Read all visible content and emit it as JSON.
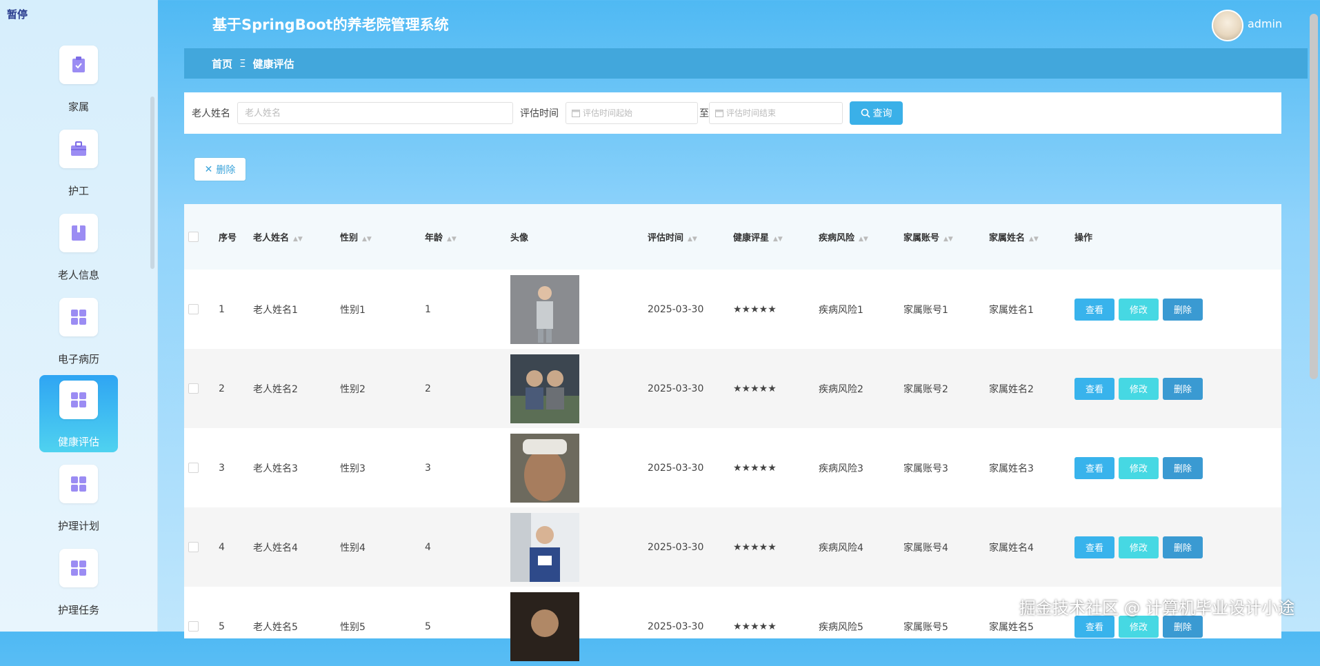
{
  "sidebar": {
    "pause_label": "暂停",
    "items": [
      {
        "label": "家属",
        "icon": "clipboard-check-icon"
      },
      {
        "label": "护工",
        "icon": "briefcase-icon"
      },
      {
        "label": "老人信息",
        "icon": "book-icon"
      },
      {
        "label": "电子病历",
        "icon": "grid-icon"
      },
      {
        "label": "健康评估",
        "icon": "grid-icon",
        "active": true
      },
      {
        "label": "护理计划",
        "icon": "grid-icon"
      },
      {
        "label": "护理任务",
        "icon": "grid-icon"
      }
    ]
  },
  "header": {
    "title": "基于SpringBoot的养老院管理系统",
    "username": "admin"
  },
  "breadcrumb": {
    "home": "首页",
    "separator": "Ξ",
    "current": "健康评估"
  },
  "search": {
    "name_label": "老人姓名",
    "name_placeholder": "老人姓名",
    "time_label": "评估时间",
    "start_placeholder": "评估时间起始",
    "to_label": "至",
    "end_placeholder": "评估时间结束",
    "query_label": "查询"
  },
  "toolbar": {
    "delete_label": "删除"
  },
  "table": {
    "headers": {
      "no": "序号",
      "name": "老人姓名",
      "sex": "性别",
      "age": "年龄",
      "photo": "头像",
      "time": "评估时间",
      "rating": "健康评星",
      "risk": "疾病风险",
      "account": "家属账号",
      "fname": "家属姓名",
      "ops": "操作"
    },
    "rows": [
      {
        "no": "1",
        "name": "老人姓名1",
        "sex": "性别1",
        "age": "1",
        "time": "2025-03-30",
        "rating": "★★★★★",
        "risk": "疾病风险1",
        "account": "家属账号1",
        "fname": "家属姓名1"
      },
      {
        "no": "2",
        "name": "老人姓名2",
        "sex": "性别2",
        "age": "2",
        "time": "2025-03-30",
        "rating": "★★★★★",
        "risk": "疾病风险2",
        "account": "家属账号2",
        "fname": "家属姓名2"
      },
      {
        "no": "3",
        "name": "老人姓名3",
        "sex": "性别3",
        "age": "3",
        "time": "2025-03-30",
        "rating": "★★★★★",
        "risk": "疾病风险3",
        "account": "家属账号3",
        "fname": "家属姓名3"
      },
      {
        "no": "4",
        "name": "老人姓名4",
        "sex": "性别4",
        "age": "4",
        "time": "2025-03-30",
        "rating": "★★★★★",
        "risk": "疾病风险4",
        "account": "家属账号4",
        "fname": "家属姓名4"
      },
      {
        "no": "5",
        "name": "老人姓名5",
        "sex": "性别5",
        "age": "5",
        "time": "2025-03-30",
        "rating": "★★★★★",
        "risk": "疾病风险5",
        "account": "家属账号5",
        "fname": "家属姓名5"
      }
    ],
    "op_labels": {
      "view": "查看",
      "edit": "修改",
      "delete": "删除"
    }
  },
  "watermark": "掘金技术社区 @ 计算机毕业设计小途",
  "colors": {
    "accent": "#3ab0e8",
    "breadcrumb": "#42a7dc",
    "edit": "#46d8e3",
    "delete": "#3a9ad2"
  }
}
